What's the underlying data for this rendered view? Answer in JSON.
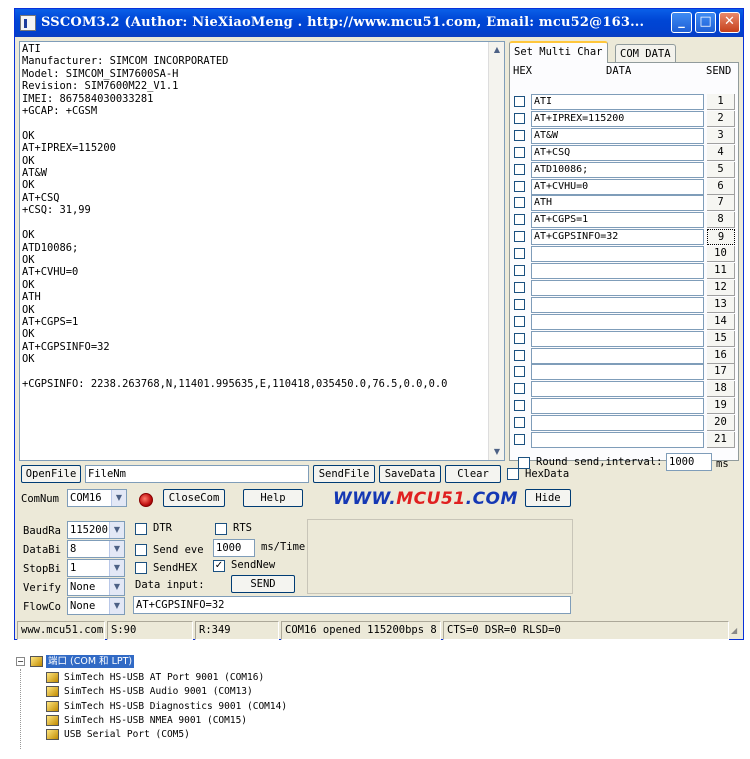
{
  "window": {
    "title": "SSCOM3.2 (Author: NieXiaoMeng . http://www.mcu51.com, Email: mcu52@163...",
    "minimize_glyph": "_",
    "maximize_glyph": "□",
    "close_glyph": "✕"
  },
  "receive": {
    "text": "ATI\nManufacturer: SIMCOM INCORPORATED\nModel: SIMCOM_SIM7600SA-H\nRevision: SIM7600M22_V1.1\nIMEI: 867584030033281\n+GCAP: +CGSM\n\nOK\nAT+IPREX=115200\nOK\nAT&W\nOK\nAT+CSQ\n+CSQ: 31,99\n\nOK\nATD10086;\nOK\nAT+CVHU=0\nOK\nATH\nOK\nAT+CGPS=1\nOK\nAT+CGPSINFO=32\nOK\n\n+CGPSINFO: 2238.263768,N,11401.995635,E,110418,035450.0,76.5,0.0,0.0"
  },
  "multi": {
    "tab_set": "Set Multi Char",
    "tab_com": "COM DATA",
    "col_hex": "HEX",
    "col_data": "DATA",
    "col_send": "SEND",
    "rows": [
      {
        "num": "1",
        "data": "ATI"
      },
      {
        "num": "2",
        "data": "AT+IPREX=115200"
      },
      {
        "num": "3",
        "data": "AT&W"
      },
      {
        "num": "4",
        "data": "AT+CSQ"
      },
      {
        "num": "5",
        "data": "ATD10086;"
      },
      {
        "num": "6",
        "data": "AT+CVHU=0"
      },
      {
        "num": "7",
        "data": "ATH"
      },
      {
        "num": "8",
        "data": "AT+CGPS=1"
      },
      {
        "num": "9",
        "data": "AT+CGPSINFO=32"
      },
      {
        "num": "10",
        "data": ""
      },
      {
        "num": "11",
        "data": ""
      },
      {
        "num": "12",
        "data": ""
      },
      {
        "num": "13",
        "data": ""
      },
      {
        "num": "14",
        "data": ""
      },
      {
        "num": "15",
        "data": ""
      },
      {
        "num": "16",
        "data": ""
      },
      {
        "num": "17",
        "data": ""
      },
      {
        "num": "18",
        "data": ""
      },
      {
        "num": "19",
        "data": ""
      },
      {
        "num": "20",
        "data": ""
      },
      {
        "num": "21",
        "data": ""
      }
    ],
    "round_send_label": "Round send,interval:",
    "interval_value": "1000",
    "interval_unit": "ms"
  },
  "controls": {
    "open_file": "OpenFile",
    "file_name": "FileNm",
    "send_file": "SendFile",
    "save_data": "SaveData",
    "clear": "Clear",
    "hex_data": "HexData",
    "com_num_label": "ComNum",
    "com_num_value": "COM16",
    "close_com": "CloseCom",
    "help": "Help",
    "hide": "Hide",
    "logo_a": "WWW.",
    "logo_b": "MCU51",
    "logo_c": ".COM",
    "baud_label": "BaudRa",
    "baud_value": "115200",
    "databits_label": "DataBi",
    "databits_value": "8",
    "stopbits_label": "StopBi",
    "stopbits_value": "1",
    "verify_label": "Verify",
    "verify_value": "None",
    "flow_label": "FlowCo",
    "flow_value": "None",
    "dtr": "DTR",
    "rts": "RTS",
    "send_every": "Send eve",
    "send_every_value": "1000",
    "ms_time": "ms/Time",
    "send_hex": "SendHEX",
    "send_new": "SendNew",
    "data_input_label": "Data input:",
    "send": "SEND",
    "data_input_value": "AT+CGPSINFO=32"
  },
  "status": {
    "site": "www.mcu51.com",
    "sent": "S:90",
    "received": "R:349",
    "port_state": "COM16 opened 115200bps  8",
    "lines": "CTS=0 DSR=0 RLSD=0"
  },
  "tree": {
    "category": "端口 (COM 和 LPT)",
    "items": [
      "SimTech HS-USB AT Port 9001 (COM16)",
      "SimTech HS-USB Audio 9001 (COM13)",
      "SimTech HS-USB Diagnostics 9001 (COM14)",
      "SimTech HS-USB NMEA 9001 (COM15)",
      "USB Serial Port (COM5)"
    ]
  }
}
